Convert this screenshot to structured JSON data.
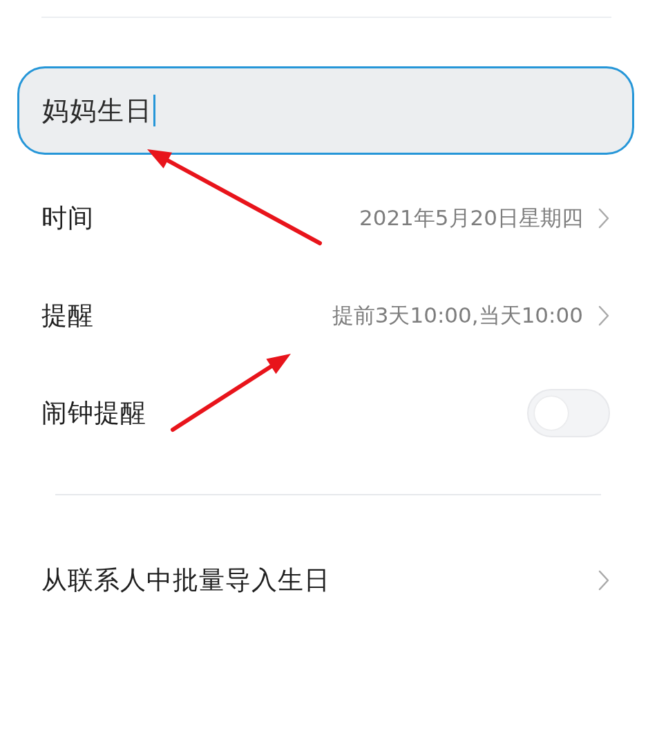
{
  "title_field": {
    "value": "妈妈生日",
    "focused": true
  },
  "settings": [
    {
      "kind": "link",
      "label": "时间",
      "value": "2021年5月20日星期四"
    },
    {
      "kind": "link",
      "label": "提醒",
      "value": "提前3天10:00,当天10:00"
    },
    {
      "kind": "toggle",
      "label": "闹钟提醒",
      "on": false
    }
  ],
  "actions": [
    {
      "kind": "link",
      "label": "从联系人中批量导入生日"
    }
  ]
}
